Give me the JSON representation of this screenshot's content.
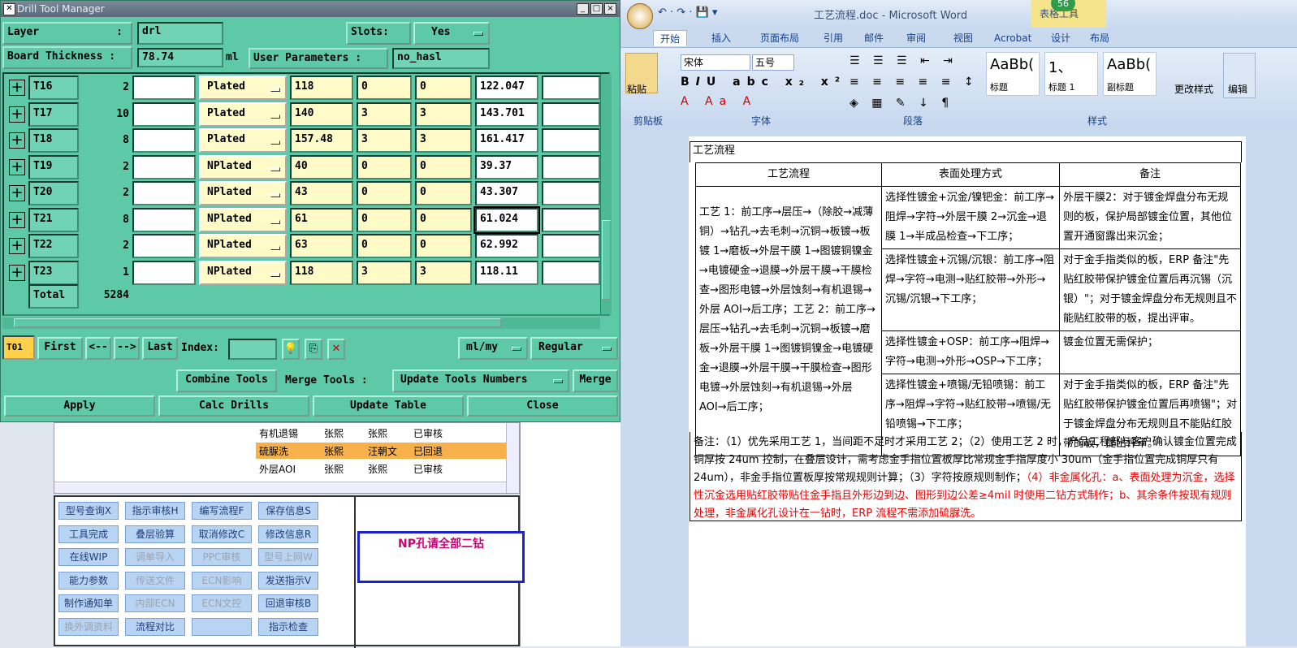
{
  "drill": {
    "title": "Drill Tool Manager",
    "layer_label": "Layer",
    "layer_colon": ":",
    "layer_value": "drl",
    "slots_label": "Slots:",
    "slots_value": "Yes",
    "thickness_label": "Board Thickness :",
    "thickness_value": "78.74",
    "thickness_unit": "ml",
    "user_params_label": "User Parameters :",
    "user_params_value": "no_hasl",
    "rows": [
      {
        "tool": "T16",
        "count": "2",
        "type": "Plated",
        "v1": "118",
        "v2": "0",
        "v3": "0",
        "v4": "122.047"
      },
      {
        "tool": "T17",
        "count": "10",
        "type": "Plated",
        "v1": "140",
        "v2": "3",
        "v3": "3",
        "v4": "143.701"
      },
      {
        "tool": "T18",
        "count": "8",
        "type": "Plated",
        "v1": "157.48",
        "v2": "3",
        "v3": "3",
        "v4": "161.417"
      },
      {
        "tool": "T19",
        "count": "2",
        "type": "NPlated",
        "v1": "40",
        "v2": "0",
        "v3": "0",
        "v4": "39.37"
      },
      {
        "tool": "T20",
        "count": "2",
        "type": "NPlated",
        "v1": "43",
        "v2": "0",
        "v3": "0",
        "v4": "43.307"
      },
      {
        "tool": "T21",
        "count": "8",
        "type": "NPlated",
        "v1": "61",
        "v2": "0",
        "v3": "0",
        "v4": "61.024"
      },
      {
        "tool": "T22",
        "count": "2",
        "type": "NPlated",
        "v1": "63",
        "v2": "0",
        "v3": "0",
        "v4": "62.992"
      },
      {
        "tool": "T23",
        "count": "1",
        "type": "NPlated",
        "v1": "118",
        "v2": "3",
        "v3": "3",
        "v4": "118.11"
      }
    ],
    "total_label": "Total",
    "total_value": "5284",
    "nav": {
      "current": "T01",
      "first": "First",
      "prev": "<--",
      "next": "-->",
      "last": "Last",
      "index_label": "Index:",
      "units": "ml/my",
      "mode": "Regular"
    },
    "combine": "Combine Tools",
    "merge_label": "Merge Tools :",
    "merge_option": "Update Tools Numbers",
    "merge": "Merge",
    "apply": "Apply",
    "calc": "Calc Drills",
    "update": "Update Table",
    "close": "Close"
  },
  "lower": {
    "table_rows": [
      [
        "有机退锡",
        "张熙",
        "张熙",
        "已审核"
      ],
      [
        "硫脲洗",
        "张熙",
        "汪朝文",
        "已回退"
      ],
      [
        "外层AOI",
        "张熙",
        "张熙",
        "已审核"
      ]
    ],
    "buttons": [
      [
        "型号查询X",
        "指示审核H",
        "编写流程F",
        "保存信息S"
      ],
      [
        "工具完成",
        "叠层验算",
        "取消修改C",
        "修改信息R"
      ],
      [
        "在线WIP",
        "调单导入",
        "PPC审核",
        "型号上网W"
      ],
      [
        "能力参数",
        "传送文件",
        "ECN影响",
        "发送指示V"
      ],
      [
        "制作通知单",
        "内部ECN",
        "ECN文控",
        "回退审核B"
      ],
      [
        "换外调资料",
        "流程对比",
        "",
        "指示检查"
      ]
    ],
    "note": "NP孔请全部二钻"
  },
  "word": {
    "title": "工艺流程.doc - Microsoft Word",
    "context_tab": "表格工具",
    "badge": "56",
    "tabs": [
      "开始",
      "插入",
      "页面布局",
      "引用",
      "邮件",
      "审阅",
      "视图",
      "Acrobat",
      "设计",
      "布局"
    ],
    "font_name": "宋体",
    "font_size": "五号",
    "paste": "粘贴",
    "styles": [
      {
        "sample": "AaBb(",
        "name": "标题"
      },
      {
        "sample": "1、",
        "name": "标题 1"
      },
      {
        "sample": "AaBb(",
        "name": "副标题"
      }
    ],
    "change_styles": "更改样式",
    "edit": "编辑",
    "groups": [
      "剪贴板",
      "字体",
      "段落",
      "样式"
    ],
    "doc_title": "工艺流程",
    "headers": [
      "工艺流程",
      "表面处理方式",
      "备注"
    ],
    "col1": "工艺 1：前工序→层压→（除胶→减薄铜）→钻孔→去毛刺→沉铜→板镀→板镀 1→磨板→外层干膜 1→图镀铜镍金→电镀硬金→退膜→外层干膜→干膜检查→图形电镀→外层蚀刻→有机退锡→外层 AOI→后工序；工艺 2：前工序→层压→钻孔→去毛刺→沉铜→板镀→磨板→外层干膜 1→图镀铜镍金→电镀硬金→退膜→外层干膜→干膜检查→图形电镀→外层蚀刻→有机退锡→外层 AOI→后工序；",
    "surface": [
      "选择性镀金+沉金/镍钯金：前工序→阻焊→字符→外层干膜 2→沉金→退膜 1→半成品检查→下工序；",
      "选择性镀金+沉锡/沉银：前工序→阻焊→字符→电测→贴红胶带→外形→沉锡/沉银→下工序；",
      "选择性镀金+OSP：前工序→阻焊→字符→电测→外形→OSP→下工序；",
      "选择性镀金+喷锡/无铅喷锡：前工序→阻焊→字符→贴红胶带→喷锡/无铅喷锡→下工序；"
    ],
    "remarks": [
      "外层干膜2：对于镀金焊盘分布无规则的板，保护局部镀金位置，其他位置开通窗露出来沉金；",
      "对于金手指类似的板，ERP 备注\"先贴红胶带保护镀金位置后再沉锡（沉银）\"；对于镀金焊盘分布无规则且不能贴红胶带的板，提出评审。",
      "镀金位置无需保护；",
      "对于金手指类似的板，ERP 备注\"先贴红胶带保护镀金位置后再喷锡\"；对于镀金焊盘分布无规则且不能贴红胶带的板，提出评审。"
    ],
    "note_black": "备注：（1）优先采用工艺 1，当间距不足时才采用工艺 2；（2）使用工艺 2 时，产品工程部与客户确认镀金位置完成铜厚按 24um 控制，在叠层设计，需考虑金手指位置板厚比常规金手指厚度小 30um（金手指位置完成铜厚只有 24um），非金手指位置板厚按常规规则计算；（3）字符按原规则制作；",
    "note_red": "（4）非金属化孔：a、表面处理为沉金，选择性沉金选用贴红胶带贴住金手指且外形边到边、图形到边公差≥4mil 时使用二钻方式制作；b、其余条件按现有规则处理，非金属化孔设计在一钻时，ERP 流程不需添加硫脲洗。"
  }
}
